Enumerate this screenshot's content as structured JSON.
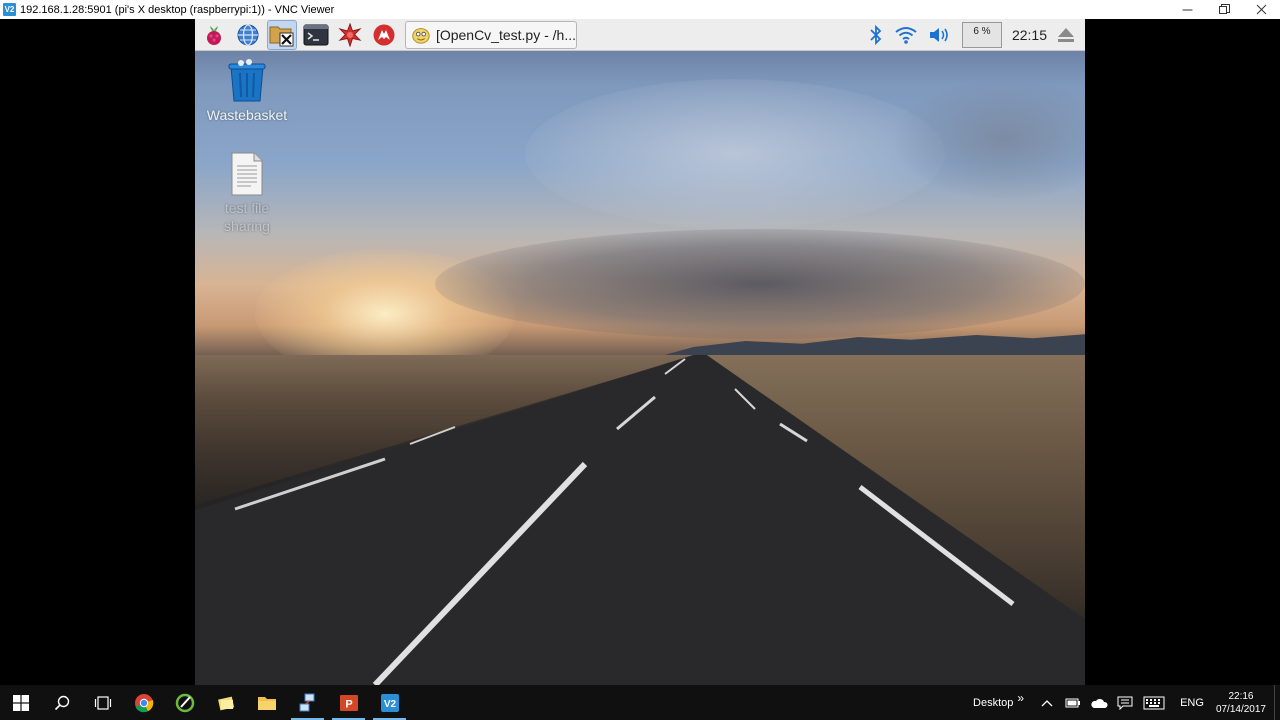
{
  "vnc_window": {
    "title": "192.168.1.28:5901 (pi's X desktop (raspberrypi:1)) - VNC Viewer",
    "logo_text": "V2"
  },
  "pi_panel": {
    "launchers": [
      "raspberry-menu",
      "web-browser",
      "file-manager",
      "terminal",
      "mathematica",
      "wolfram"
    ],
    "taskbutton_label": "[OpenCv_test.py - /h...",
    "cpu_usage": "6 %",
    "clock": "22:15"
  },
  "desktop": {
    "icons": [
      {
        "label": "Wastebasket"
      },
      {
        "label": "test file",
        "label2": "sharing"
      }
    ]
  },
  "win_taskbar": {
    "toolbar_label": "Desktop",
    "chevron": "»",
    "language": "ENG",
    "time": "22:16",
    "date": "07/14/2017",
    "pinned": [
      "start",
      "search",
      "task-view",
      "chrome",
      "stylus-app",
      "notes-app",
      "file-explorer",
      "network-app",
      "powerpoint",
      "vnc-viewer"
    ]
  },
  "colors": {
    "panel_bg": "#ededed",
    "taskbar_bg": "#101010",
    "vnc_blue": "#2a8fd6",
    "running_indicator": "#76b9ed"
  }
}
